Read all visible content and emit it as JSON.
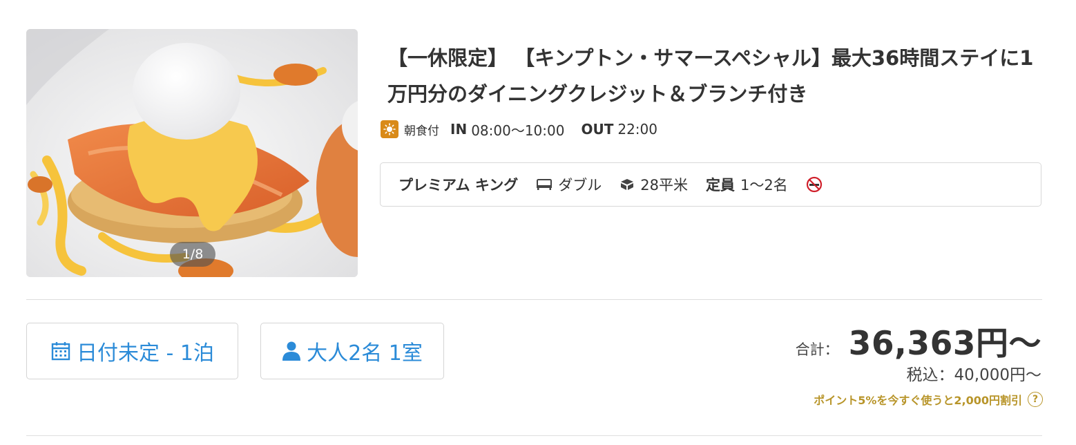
{
  "plan": {
    "image_counter": "1/8",
    "title": "【一休限定】 【キンプトン・サマースペシャル】最大36時間ステイに1万円分のダイニングクレジット＆ブランチ付き",
    "meal_icon": "sun-icon",
    "meal_label": "朝食付",
    "checkin_label": "IN",
    "checkin_time": "08:00〜10:00",
    "checkout_label": "OUT",
    "checkout_time": "22:00"
  },
  "room": {
    "name": "プレミアム キング",
    "bed_icon": "bed-icon",
    "bed": "ダブル",
    "size_icon": "cube-icon",
    "size": "28平米",
    "capacity_label": "定員",
    "capacity": "1〜2名",
    "smoking_icon": "no-smoking-icon"
  },
  "search": {
    "date_icon": "calendar-icon",
    "date_label": "日付未定 - 1泊",
    "guests_icon": "person-icon",
    "guests_label": "大人2名 1室"
  },
  "price": {
    "total_label": "合計：",
    "total": "36,363円〜",
    "tax_label": "税込：40,000円〜",
    "points_note": "ポイント5%を今すぐ使うと2,000円割引",
    "help_icon": "question-circle-icon",
    "help_glyph": "?"
  },
  "colors": {
    "accent_blue": "#2b8bd8",
    "points_gold": "#b8952a",
    "meal_badge": "#d98a18",
    "no_smoking_red": "#d0202b"
  }
}
